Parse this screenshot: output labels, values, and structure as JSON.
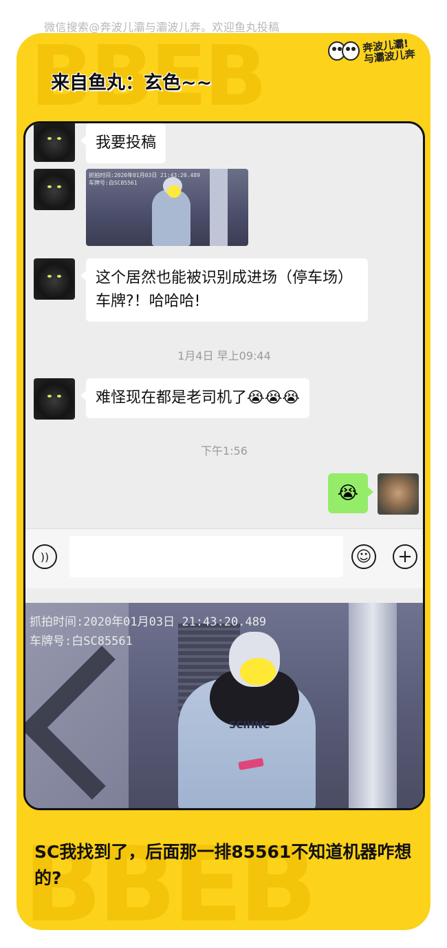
{
  "header_text": "微信搜索@奔波儿灞与灞波儿奔。欢迎鱼丸投稿",
  "brand": {
    "line1": "奔波儿灞!",
    "line2": "与灞波儿奔"
  },
  "background_word": "BBEB",
  "headline": "来自鱼丸：玄色~~",
  "chat": {
    "messages": [
      {
        "text": "我要投稿"
      },
      {
        "image_caption_line1": "抓拍时间:2020年01月03日 21:43:20.489",
        "image_caption_line2": "车牌号:白SC85561",
        "image_shirt_text": "SCIHNC"
      },
      {
        "text": "这个居然也能被识别成进场（停车场）车牌?！哈哈哈!"
      },
      {
        "timestamp": "1月4日 早上09:44"
      },
      {
        "text": "难怪现在都是老司机了",
        "emoji": "😭😭😭"
      },
      {
        "timestamp": "下午1:56"
      },
      {
        "me_emoji": "😭"
      }
    ],
    "input": {
      "placeholder": ""
    }
  },
  "photo": {
    "caption_line1": "抓拍时间:2020年01月03日 21:43:20.489",
    "caption_line2": "车牌号:白SC85561",
    "shirt_text": "SCIHNC"
  },
  "bottom_caption": "SC我找到了，后面那一排85561不知道机器咋想的?",
  "colors": {
    "card_yellow": "#fcd21a",
    "chat_bg": "#ededed",
    "my_bubble": "#95ec69"
  }
}
